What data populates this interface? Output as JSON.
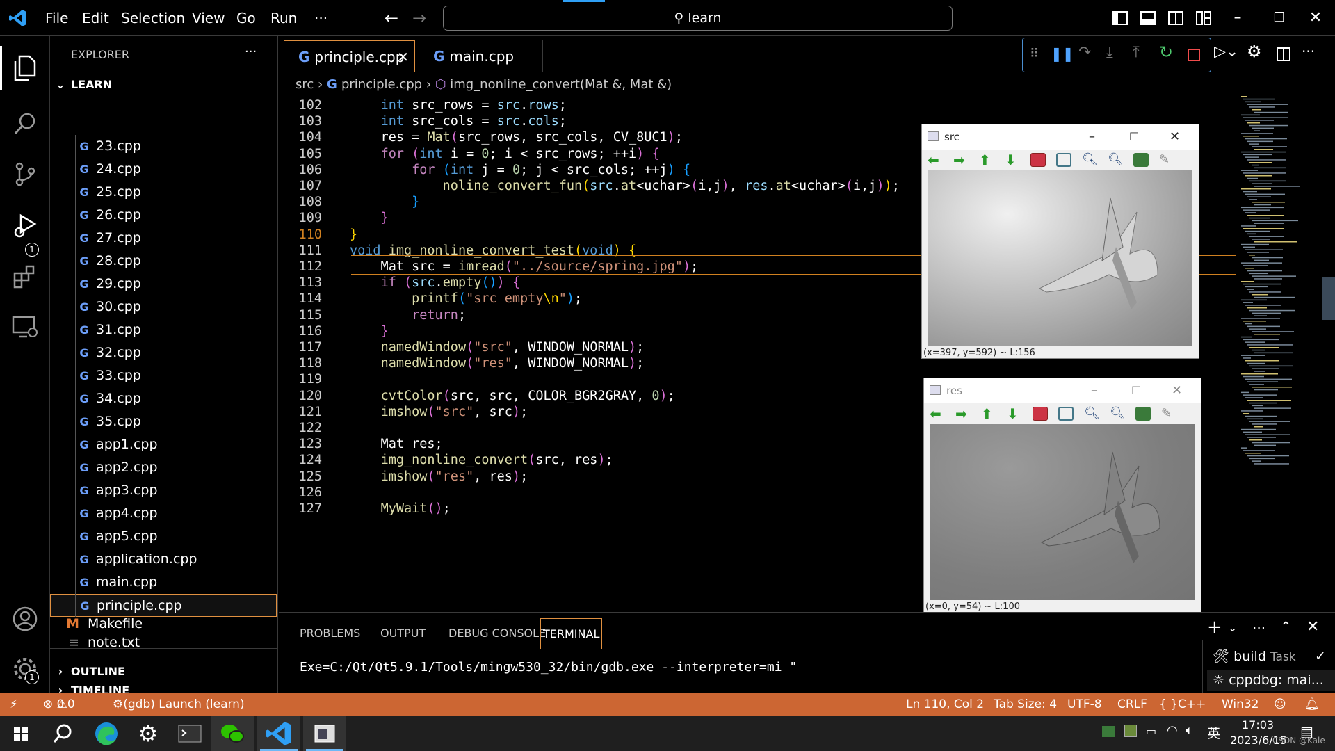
{
  "titlebar": {
    "menu": [
      "File",
      "Edit",
      "Selection",
      "View",
      "Go",
      "Run",
      "···"
    ],
    "search": "learn"
  },
  "activity": {
    "debug_badge": "1",
    "settings_badge": "1"
  },
  "explorer": {
    "title": "EXPLORER",
    "more": "···",
    "folder": "LEARN",
    "files": [
      "23.cpp",
      "24.cpp",
      "25.cpp",
      "26.cpp",
      "27.cpp",
      "28.cpp",
      "29.cpp",
      "30.cpp",
      "31.cpp",
      "32.cpp",
      "33.cpp",
      "34.cpp",
      "35.cpp",
      "app1.cpp",
      "app2.cpp",
      "app3.cpp",
      "app4.cpp",
      "app5.cpp",
      "application.cpp",
      "main.cpp",
      "principle.cpp"
    ],
    "makefile": "Makefile",
    "makefile_icon": "M",
    "note": "note.txt",
    "outline": "OUTLINE",
    "timeline": "TIMELINE"
  },
  "tabs": [
    {
      "label": "principle.cpp",
      "active": true
    },
    {
      "label": "main.cpp",
      "active": false
    }
  ],
  "breadcrumb": {
    "folder": "src",
    "file": "principle.cpp",
    "symbol": "img_nonline_convert(Mat &, Mat &)"
  },
  "code": {
    "line_numbers": [
      "102",
      "103",
      "104",
      "105",
      "106",
      "107",
      "108",
      "109",
      "110",
      "111",
      "112",
      "113",
      "114",
      "115",
      "116",
      "117",
      "118",
      "119",
      "120",
      "121",
      "122",
      "123",
      "124",
      "125",
      "126",
      "127"
    ],
    "current_line": "110"
  },
  "cv_windows": [
    {
      "title": "src",
      "status": "(x=397, y=592) ~ L:156"
    },
    {
      "title": "res",
      "status": "(x=0, y=54) ~ L:100"
    }
  ],
  "panel": {
    "tabs": [
      "PROBLEMS",
      "OUTPUT",
      "DEBUG CONSOLE",
      "TERMINAL"
    ],
    "active_tab": "TERMINAL",
    "terminal_text": "Exe=C:/Qt/Qt5.9.1/Tools/mingw530_32/bin/gdb.exe --interpreter=mi \"",
    "tasks": [
      {
        "label": "build",
        "kind": "Task"
      },
      {
        "label": "cppdbg: mai..."
      }
    ]
  },
  "status": {
    "errors": "0",
    "warnings": "0",
    "launch": "(gdb) Launch (learn)",
    "position": "Ln 110, Col 2",
    "tab_size": "Tab Size: 4",
    "encoding": "UTF-8",
    "eol": "CRLF",
    "language": "C++",
    "platform": "Win32"
  },
  "taskbar": {
    "ime": "英",
    "time": "17:03",
    "date": "2023/6/15",
    "watermark": "CSDN @Kale"
  },
  "colors": {
    "status_bg": "#cc6633",
    "accent": "#6c9ef8",
    "current_line_border": "#d08020"
  }
}
